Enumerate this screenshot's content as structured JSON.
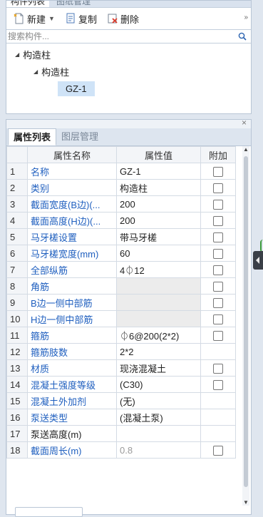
{
  "top_panel": {
    "tabs": [
      "构件列表",
      "图纸管理"
    ],
    "toolbar": {
      "new_label": "新建",
      "copy_label": "复制",
      "delete_label": "删除",
      "more": "»"
    },
    "search": {
      "placeholder": "搜索构件...",
      "value": ""
    },
    "tree": {
      "root": "构造柱",
      "child": "构造柱",
      "leaf": "GZ-1"
    }
  },
  "bottom_panel": {
    "close": "×",
    "tabs": {
      "active": "属性列表",
      "inactive": "图层管理"
    },
    "columns": {
      "name": "属性名称",
      "value": "属性值",
      "extra": "附加"
    },
    "rows": [
      {
        "idx": "1",
        "name": "名称",
        "value": "GZ-1",
        "check": true,
        "blue": true
      },
      {
        "idx": "2",
        "name": "类别",
        "value": "构造柱",
        "check": true,
        "blue": true
      },
      {
        "idx": "3",
        "name": "截面宽度(B边)(...",
        "value": "200",
        "check": true,
        "blue": true
      },
      {
        "idx": "4",
        "name": "截面高度(H边)(...",
        "value": "200",
        "check": true,
        "blue": true
      },
      {
        "idx": "5",
        "name": "马牙槎设置",
        "value": "带马牙槎",
        "check": true,
        "blue": true
      },
      {
        "idx": "6",
        "name": "马牙槎宽度(mm)",
        "value": "60",
        "check": true,
        "blue": true
      },
      {
        "idx": "7",
        "name": "全部纵筋",
        "value": "4⏀12",
        "check": true,
        "blue": true
      },
      {
        "idx": "8",
        "name": "角筋",
        "value": "",
        "check": true,
        "blue": true,
        "gray": true
      },
      {
        "idx": "9",
        "name": "B边一侧中部筋",
        "value": "",
        "check": true,
        "blue": true,
        "gray": true
      },
      {
        "idx": "10",
        "name": "H边一侧中部筋",
        "value": "",
        "check": true,
        "blue": true,
        "gray": true
      },
      {
        "idx": "11",
        "name": "箍筋",
        "value": "⏀6@200(2*2)",
        "check": true,
        "blue": true
      },
      {
        "idx": "12",
        "name": "箍筋肢数",
        "value": "2*2",
        "check": false,
        "blue": true
      },
      {
        "idx": "13",
        "name": "材质",
        "value": "现浇混凝土",
        "check": true,
        "blue": true
      },
      {
        "idx": "14",
        "name": "混凝土强度等级",
        "value": "(C30)",
        "check": true,
        "blue": true
      },
      {
        "idx": "15",
        "name": "混凝土外加剂",
        "value": "(无)",
        "check": false,
        "blue": true
      },
      {
        "idx": "16",
        "name": "泵送类型",
        "value": "(混凝土泵)",
        "check": false,
        "blue": true
      },
      {
        "idx": "17",
        "name": "泵送高度(m)",
        "value": "",
        "check": false,
        "blue": false
      },
      {
        "idx": "18",
        "name": "截面周长(m)",
        "value": "0.8",
        "check": true,
        "blue": true,
        "dim": true
      }
    ]
  },
  "colors": {
    "accent_blue": "#1f5fbf",
    "selection": "#cfe3f7",
    "border": "#b9c6d6"
  }
}
